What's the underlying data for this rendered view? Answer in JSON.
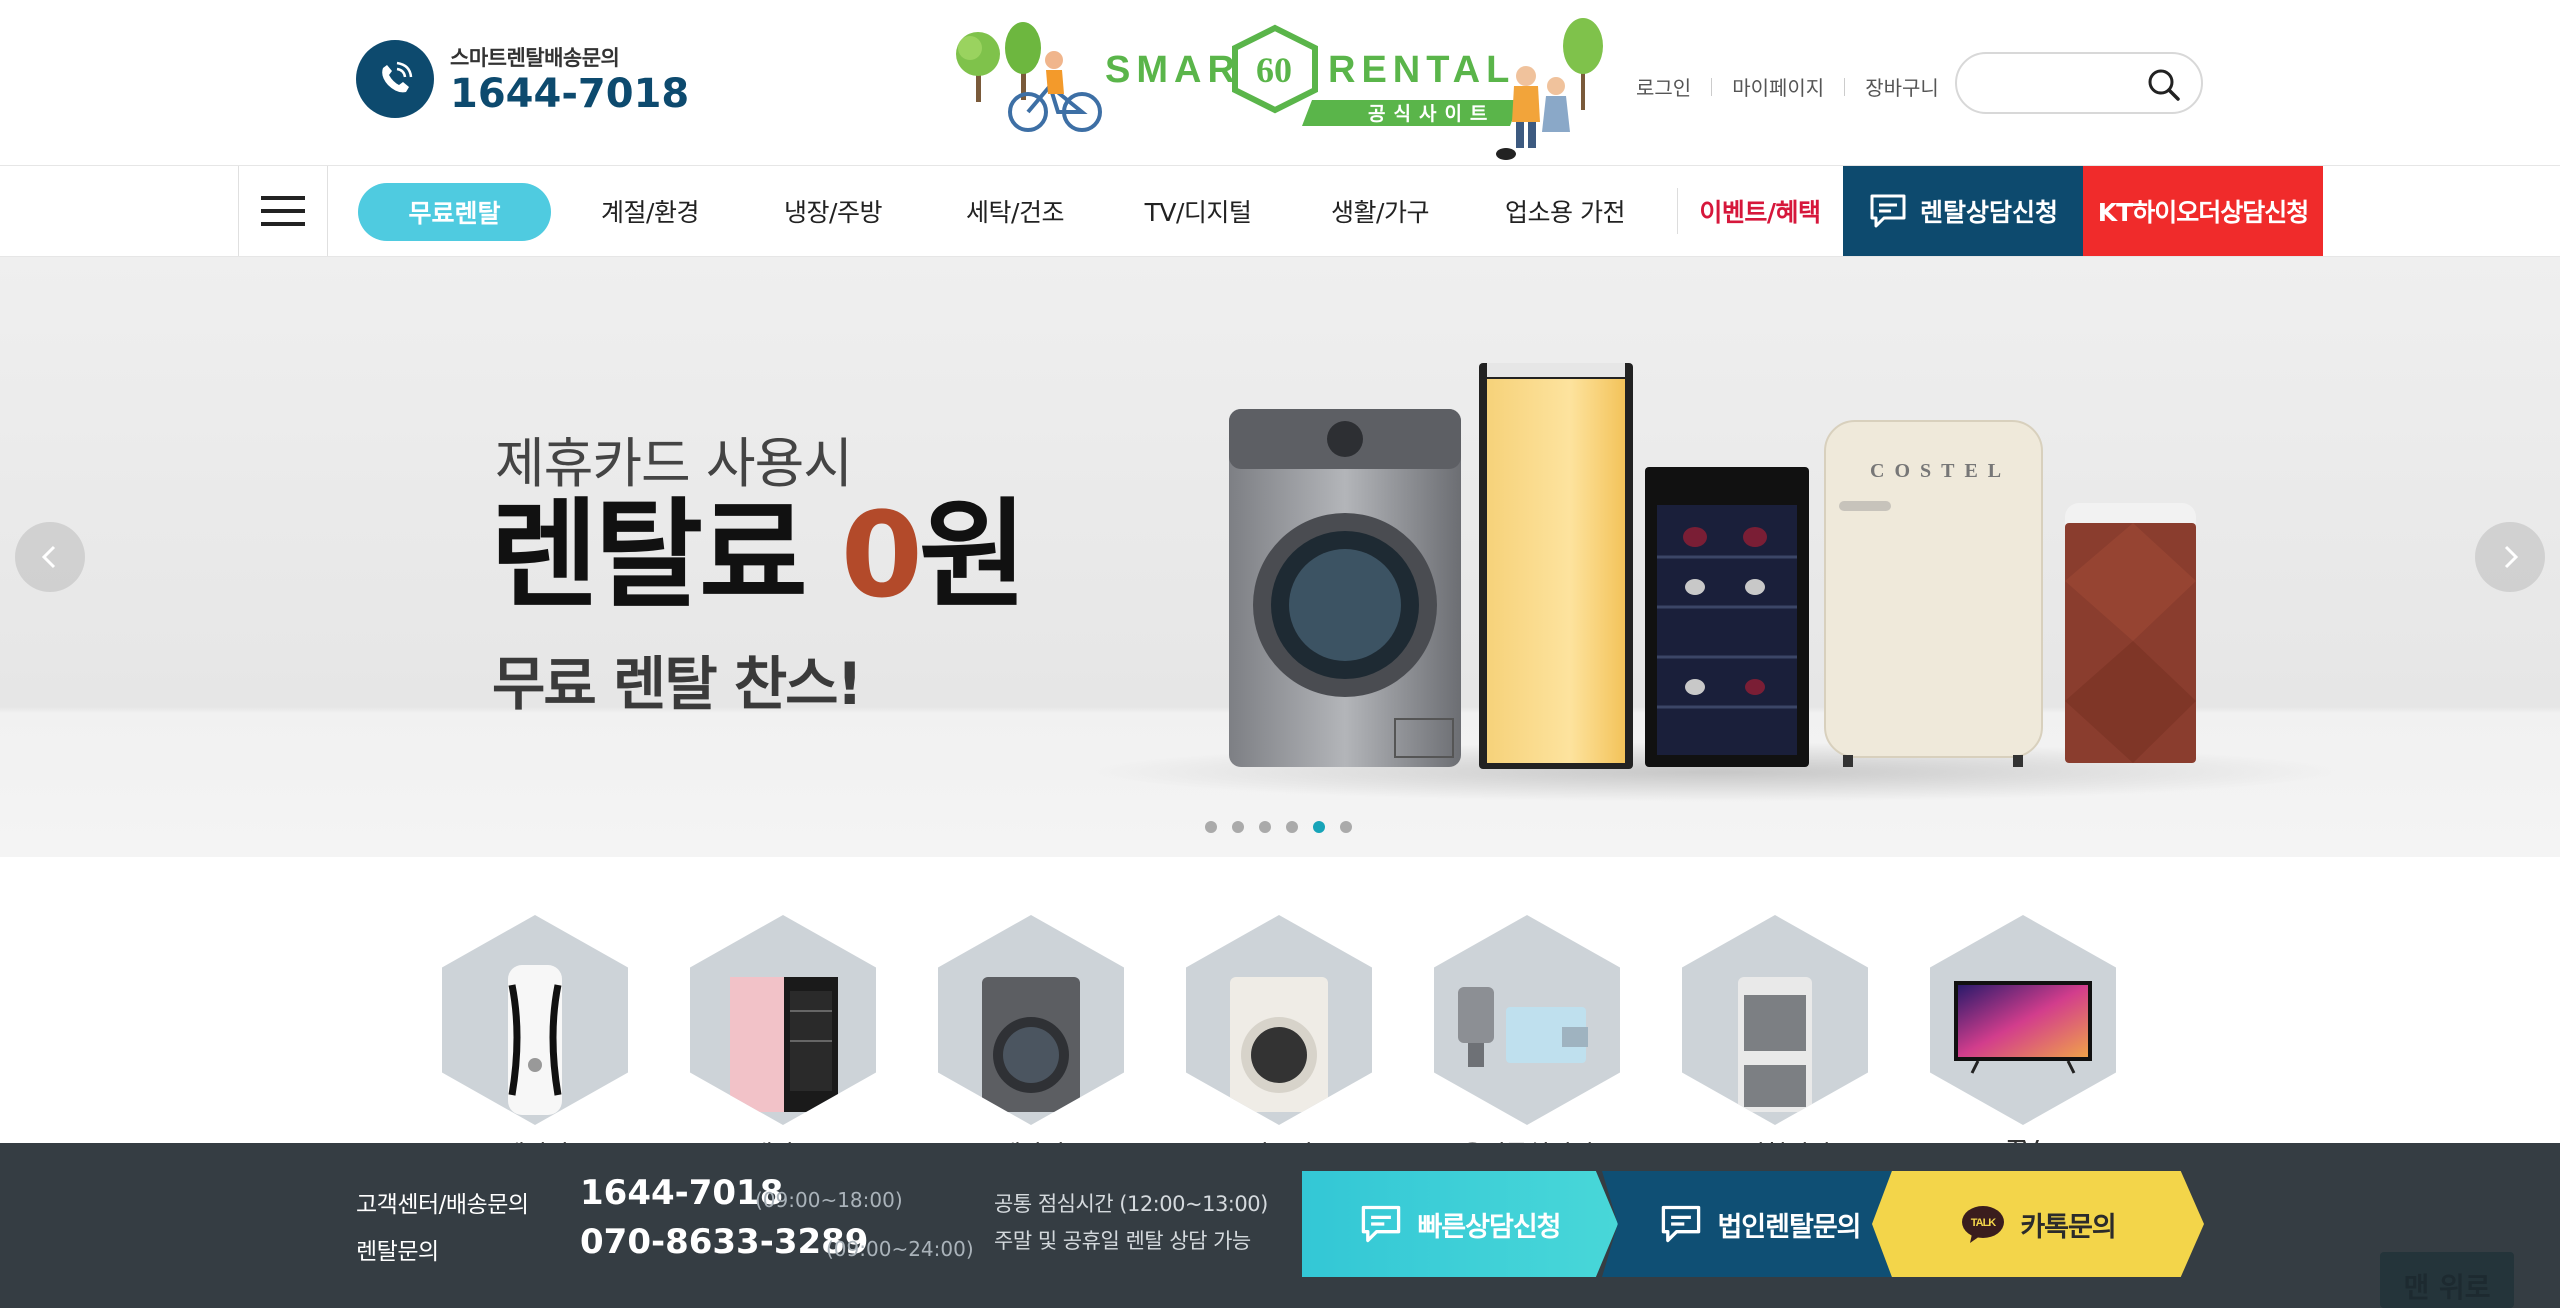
{
  "header": {
    "phone_label": "스마트렌탈배송문의",
    "phone_number": "1644-7018",
    "logo_text": "SMART",
    "logo_badge": "60",
    "logo_text2": "RENTAL",
    "logo_sub": "공식사이트",
    "links": {
      "login": "로그인",
      "mypage": "마이페이지",
      "cart": "장바구니"
    },
    "search": {
      "placeholder": ""
    }
  },
  "nav": {
    "active": "무료렌탈",
    "items": [
      "계절/환경",
      "냉장/주방",
      "세탁/건조",
      "TV/디지털",
      "생활/가구",
      "업소용 가전"
    ],
    "event": "이벤트/혜택",
    "consult": "렌탈상담신청",
    "kt": "KT하이오더상담신청"
  },
  "hero": {
    "subtitle": "제휴카드 사용시",
    "title_pre": "렌탈료 ",
    "title_zero": "0",
    "title_post": "원",
    "tagline": "무료 렌탈 찬스!",
    "product_brand": "COSTEL",
    "slides": 6,
    "active_slide": 5
  },
  "categories": [
    "에어컨",
    "냉장고",
    "세탁기",
    "건조기",
    "음식물처리기",
    "공기청정기",
    "TV"
  ],
  "bottom_bar": {
    "label_service": "고객센터/배송문의",
    "label_rental": "렌탈문의",
    "number_service": "1644-7018",
    "number_rental": "070-8633-3289",
    "hours_service": "(09:00~18:00)",
    "hours_rental": "(09:00~24:00)",
    "info_lunch": "공통 점심시간 (12:00~13:00)",
    "info_weekend": "주말 및 공휴일 렌탈 상담 가능",
    "btn_quick": "빠른상담신청",
    "btn_corp": "법인렌탈문의",
    "btn_kakao": "카톡문의",
    "kakao_badge": "TALK",
    "top_button": "맨 위로"
  },
  "colors": {
    "brand_navy": "#0d4a6e",
    "brand_cyan": "#4fcbe0",
    "kt_red": "#f02b2b",
    "event_red": "#d6173b",
    "logo_green": "#5ab54a",
    "hero_zero": "#b34a2a",
    "active_dot": "#17a4b8",
    "bar_bg": "#353d43",
    "kakao_yellow": "#f3d54a"
  }
}
